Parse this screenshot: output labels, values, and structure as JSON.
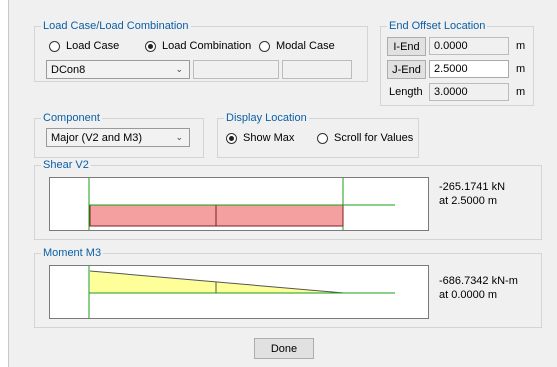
{
  "load_group": {
    "title": "Load Case/Load Combination",
    "options": [
      {
        "label": "Load Case",
        "selected": false
      },
      {
        "label": "Load Combination",
        "selected": true
      },
      {
        "label": "Modal Case",
        "selected": false
      }
    ],
    "selected_value": "DCon8"
  },
  "end_offset": {
    "title": "End Offset Location",
    "i_end": {
      "label": "I-End",
      "value": "0.0000",
      "unit": "m"
    },
    "j_end": {
      "label": "J-End",
      "value": "2.5000",
      "unit": "m"
    },
    "length": {
      "label": "Length",
      "value": "3.0000",
      "unit": "m"
    }
  },
  "component": {
    "title": "Component",
    "selected_value": "Major (V2 and M3)"
  },
  "display_location": {
    "title": "Display Location",
    "options": [
      {
        "label": "Show Max",
        "selected": true
      },
      {
        "label": "Scroll for Values",
        "selected": false
      }
    ]
  },
  "shear": {
    "title": "Shear V2",
    "value": "-265.1741 kN",
    "location": "at 2.5000 m",
    "fill_color": "#f4a0a0",
    "segments": [
      {
        "from": 0.0,
        "to": 1.25
      },
      {
        "from": 1.25,
        "to": 2.5
      }
    ]
  },
  "moment": {
    "title": "Moment M3",
    "value": "-686.7342 kN-m",
    "location": "at 0.0000 m",
    "fill_color": "#ffff99"
  },
  "done_label": "Done"
}
